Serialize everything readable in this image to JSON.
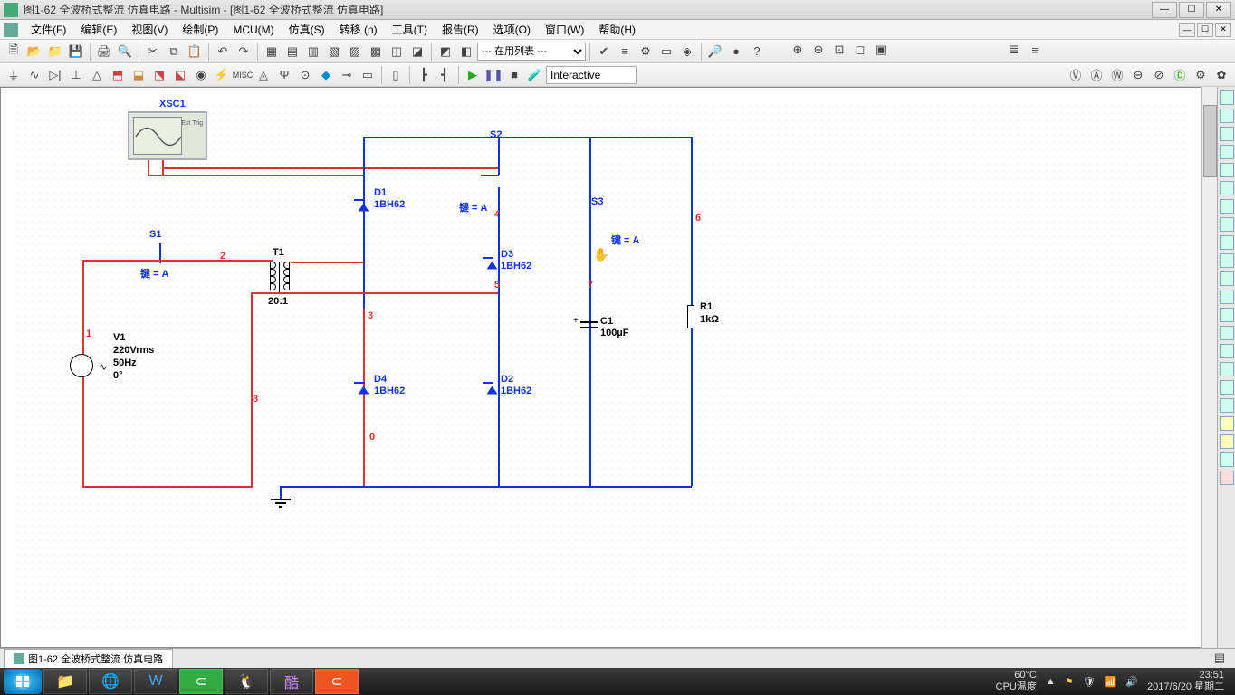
{
  "title": "图1-62  全波桥式整流 仿真电路 - Multisim - [图1-62  全波桥式整流 仿真电路]",
  "menu": {
    "file": "文件(F)",
    "edit": "编辑(E)",
    "view": "视图(V)",
    "place": "绘制(P)",
    "mcu": "MCU(M)",
    "simulate": "仿真(S)",
    "transfer": "转移 (n)",
    "tools": "工具(T)",
    "reports": "报告(R)",
    "options": "选项(O)",
    "window": "窗口(W)",
    "help": "帮助(H)"
  },
  "toolbar": {
    "list_select": "--- 在用列表 ---",
    "interactive": "Interactive"
  },
  "tab_label": "图1-62  全波桥式整流 仿真电路",
  "components": {
    "xsc1": "XSC1",
    "ext_trig": "Ext Trig",
    "s1": "S1",
    "s2": "S2",
    "s3": "S3",
    "key_s1": "键 = A",
    "key_s2": "键 = A",
    "key_s3": "键 = A",
    "v1": "V1",
    "v1_v": "220Vrms",
    "v1_f": "50Hz",
    "v1_p": "0°",
    "t1": "T1",
    "t1_ratio": "20:1",
    "d1": "D1",
    "d1_t": "1BH62",
    "d2": "D2",
    "d2_t": "1BH62",
    "d3": "D3",
    "d3_t": "1BH62",
    "d4": "D4",
    "d4_t": "1BH62",
    "c1": "C1",
    "c1_v": "100µF",
    "r1": "R1",
    "r1_v": "1kΩ",
    "n1": "1",
    "n2": "2",
    "n3": "3",
    "n4": "4",
    "n5": "5",
    "n6": "6",
    "n7": "7",
    "n8": "8",
    "n0": "0"
  },
  "tray": {
    "temp": "60°C",
    "cpu": "CPU温度",
    "time": "23:51",
    "date": "2017/6/20 星期二"
  }
}
